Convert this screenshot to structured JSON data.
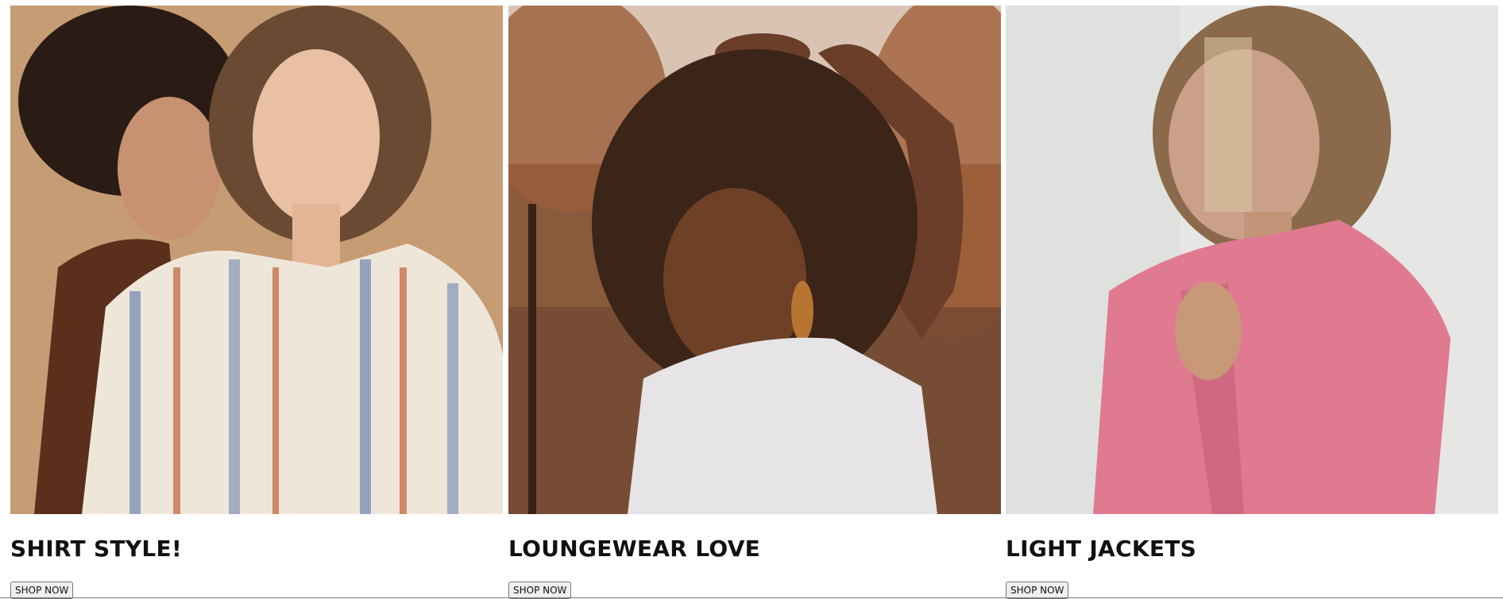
{
  "products": [
    {
      "title": "SHIRT STYLE!",
      "button_label": "SHOP NOW"
    },
    {
      "title": "LOUNGEWEAR LOVE",
      "button_label": "SHOP NOW"
    },
    {
      "title": "LIGHT JACKETS",
      "button_label": "SHOP NOW"
    }
  ],
  "colors": {
    "background": "#ffffff",
    "title_text": "#111111",
    "button_bg": "#efefef",
    "button_border": "#767676"
  }
}
